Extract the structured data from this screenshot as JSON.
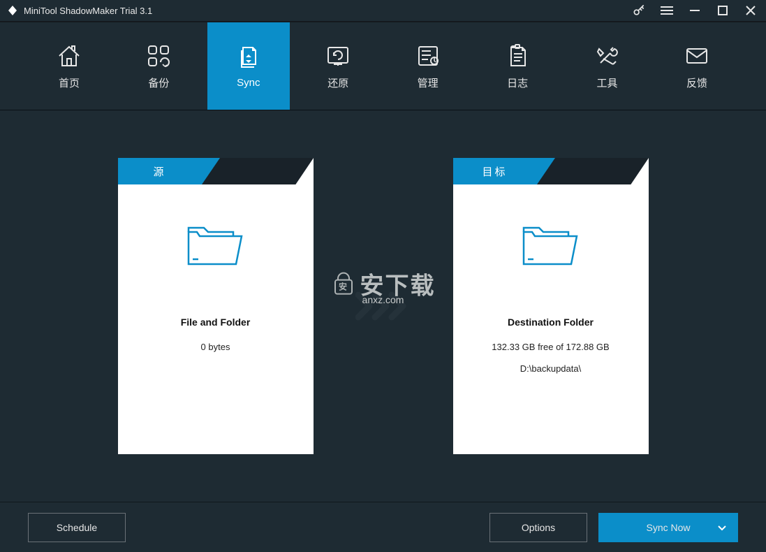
{
  "app": {
    "title": "MiniTool ShadowMaker Trial 3.1"
  },
  "nav": {
    "items": [
      {
        "label": "首页"
      },
      {
        "label": "备份"
      },
      {
        "label": "Sync"
      },
      {
        "label": "还原"
      },
      {
        "label": "管理"
      },
      {
        "label": "日志"
      },
      {
        "label": "工具"
      },
      {
        "label": "反馈"
      }
    ],
    "active_index": 2
  },
  "source": {
    "tab": "源",
    "title": "File and Folder",
    "size": "0 bytes"
  },
  "destination": {
    "tab": "目标",
    "title": "Destination Folder",
    "free": "132.33 GB free of 172.88 GB",
    "path": "D:\\backupdata\\"
  },
  "footer": {
    "schedule": "Schedule",
    "options": "Options",
    "sync_now": "Sync Now"
  },
  "watermark": {
    "main": "安下载",
    "sub": "anxz.com"
  },
  "colors": {
    "accent": "#0b8ec9",
    "bg": "#1e2b33"
  }
}
